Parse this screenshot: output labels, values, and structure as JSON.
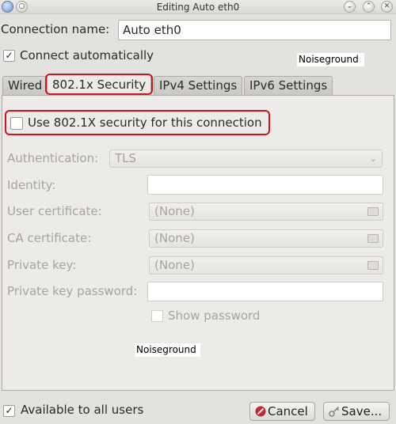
{
  "window": {
    "title": "Editing Auto eth0",
    "controls": {
      "sticky": "○",
      "minimize": "⌄",
      "maximize": "⌃",
      "close": "✕"
    }
  },
  "connection_name": {
    "label": "Connection name:",
    "value": "Auto eth0"
  },
  "connect_automatically": {
    "label": "Connect automatically",
    "checked": true
  },
  "noise_labels": [
    "Noiseground",
    "Noiseground"
  ],
  "tabs": [
    {
      "label": "Wired",
      "active": false
    },
    {
      "label": "802.1x Security",
      "active": true
    },
    {
      "label": "IPv4 Settings",
      "active": false
    },
    {
      "label": "IPv6 Settings",
      "active": false
    }
  ],
  "security": {
    "use_8021x_label": "Use 802.1X security for this connection",
    "use_8021x_checked": false,
    "authentication": {
      "label": "Authentication:",
      "value": "TLS"
    },
    "identity": {
      "label": "Identity:",
      "value": ""
    },
    "user_certificate": {
      "label": "User certificate:",
      "value": "(None)"
    },
    "ca_certificate": {
      "label": "CA certificate:",
      "value": "(None)"
    },
    "private_key": {
      "label": "Private key:",
      "value": "(None)"
    },
    "private_key_password": {
      "label": "Private key password:",
      "value": ""
    },
    "show_password": {
      "label": "Show password",
      "checked": false
    }
  },
  "footer": {
    "available_to_all_users": {
      "label": "Available to all users",
      "checked": true
    },
    "cancel_label": "Cancel",
    "save_label": "Save..."
  },
  "colors": {
    "highlight": "#d0141a",
    "background": "#e4e2df",
    "disabled_text": "#a7a4a0"
  }
}
